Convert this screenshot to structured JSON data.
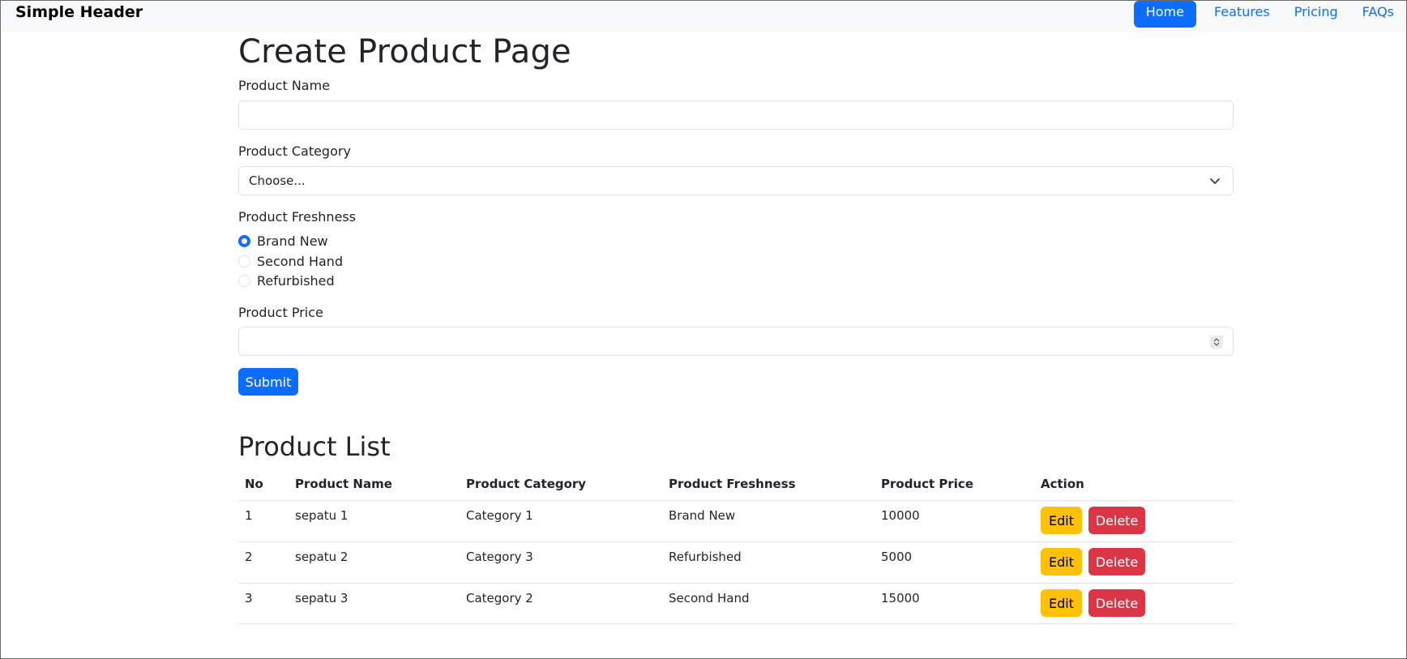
{
  "header": {
    "brand": "Simple Header",
    "nav": [
      {
        "label": "Home",
        "active": true
      },
      {
        "label": "Features",
        "active": false
      },
      {
        "label": "Pricing",
        "active": false
      },
      {
        "label": "FAQs",
        "active": false
      }
    ]
  },
  "form": {
    "title": "Create Product Page",
    "name_label": "Product Name",
    "name_value": "",
    "category_label": "Product Category",
    "category_selected": "Choose...",
    "freshness_label": "Product Freshness",
    "freshness_options": [
      {
        "label": "Brand New",
        "checked": true
      },
      {
        "label": "Second Hand",
        "checked": false
      },
      {
        "label": "Refurbished",
        "checked": false
      }
    ],
    "price_label": "Product Price",
    "price_value": "",
    "submit_label": "Submit"
  },
  "list": {
    "title": "Product List",
    "columns": [
      "No",
      "Product Name",
      "Product Category",
      "Product Freshness",
      "Product Price",
      "Action"
    ],
    "rows": [
      {
        "no": "1",
        "name": "sepatu 1",
        "category": "Category 1",
        "freshness": "Brand New",
        "price": "10000"
      },
      {
        "no": "2",
        "name": "sepatu 2",
        "category": "Category 3",
        "freshness": "Refurbished",
        "price": "5000"
      },
      {
        "no": "3",
        "name": "sepatu 3",
        "category": "Category 2",
        "freshness": "Second Hand",
        "price": "15000"
      }
    ],
    "edit_label": "Edit",
    "delete_label": "Delete"
  },
  "colors": {
    "primary": "#0d6efd",
    "warning": "#ffc107",
    "danger": "#dc3545",
    "navbar_bg": "#f8f9fa"
  }
}
